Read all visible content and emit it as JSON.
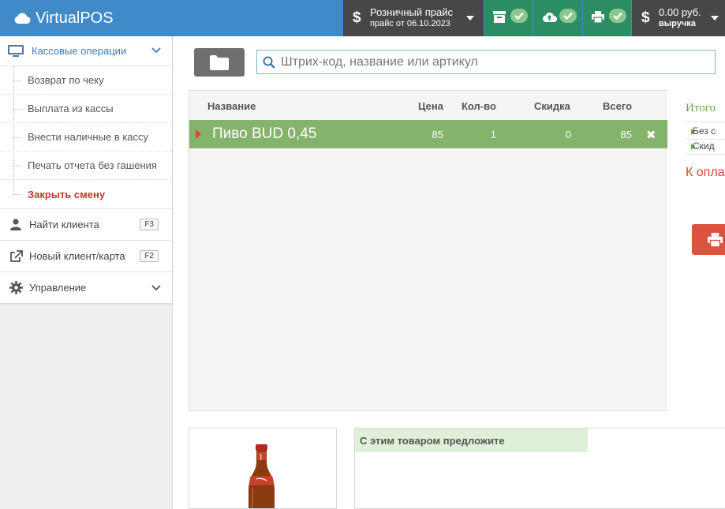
{
  "app": {
    "title": "VirtualPOS"
  },
  "header": {
    "price_title": "Розничный прайс",
    "price_sub": "прайс от 06.10.2023",
    "cash_amount": "0.00 руб.",
    "cash_label": "выручка",
    "sync_items": [
      "archive-icon",
      "cloud-upload-icon",
      "printer-icon"
    ],
    "check_color": "#8bc68f"
  },
  "sidebar": {
    "section_title": "Кассовые операции",
    "sub_items": [
      "Возврат по чеку",
      "Выплата из кассы",
      "Внести наличные в кассу",
      "Печать отчета без гашения",
      "Закрыть смену"
    ],
    "find_client": "Найти клиента",
    "find_client_key": "F3",
    "new_client": "Новый клиент/карта",
    "new_client_key": "F2",
    "management": "Управление"
  },
  "search": {
    "placeholder": "Штрих-код, название или артикул"
  },
  "table": {
    "columns": [
      "Название",
      "Цена",
      "Кол-во",
      "Скидка",
      "Всего"
    ],
    "rows": [
      {
        "name": "Пиво BUD 0,45",
        "price": "85",
        "qty": "1",
        "discount": "0",
        "total": "85"
      }
    ]
  },
  "summary": {
    "title": "Итого",
    "line1": "Без с",
    "line2": "Скид",
    "pay": "К опла"
  },
  "suggest": {
    "title": "С этим товаром предложите"
  },
  "colors": {
    "header_bg": "#418ac9",
    "row_selected": "#84b36b",
    "pay_red": "#d9472a",
    "accent_green": "#2c8c62"
  }
}
